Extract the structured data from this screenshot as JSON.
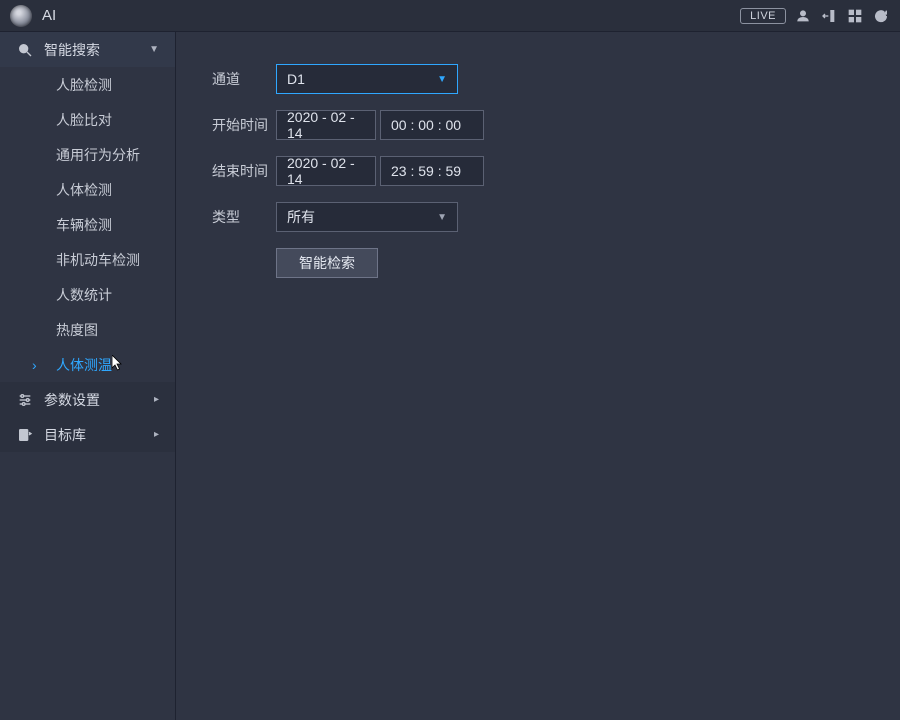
{
  "header": {
    "title": "AI",
    "live_label": "LIVE"
  },
  "sidebar": {
    "smart_search": {
      "label": "智能搜索",
      "expanded": true,
      "items": [
        {
          "label": "人脸检测"
        },
        {
          "label": "人脸比对"
        },
        {
          "label": "通用行为分析"
        },
        {
          "label": "人体检测"
        },
        {
          "label": "车辆检测"
        },
        {
          "label": "非机动车检测"
        },
        {
          "label": "人数统计"
        },
        {
          "label": "热度图"
        },
        {
          "label": "人体测温",
          "active": true
        }
      ]
    },
    "param_settings": {
      "label": "参数设置"
    },
    "target_db": {
      "label": "目标库"
    }
  },
  "form": {
    "channel": {
      "label": "通道",
      "value": "D1"
    },
    "start": {
      "label": "开始时间",
      "date": "2020 - 02 - 14",
      "time": "00 : 00 : 00"
    },
    "end": {
      "label": "结束时间",
      "date": "2020 - 02 - 14",
      "time": "23 : 59 : 59"
    },
    "type": {
      "label": "类型",
      "value": "所有"
    },
    "search_btn": "智能检索"
  },
  "colors": {
    "accent": "#2fa7ff"
  }
}
